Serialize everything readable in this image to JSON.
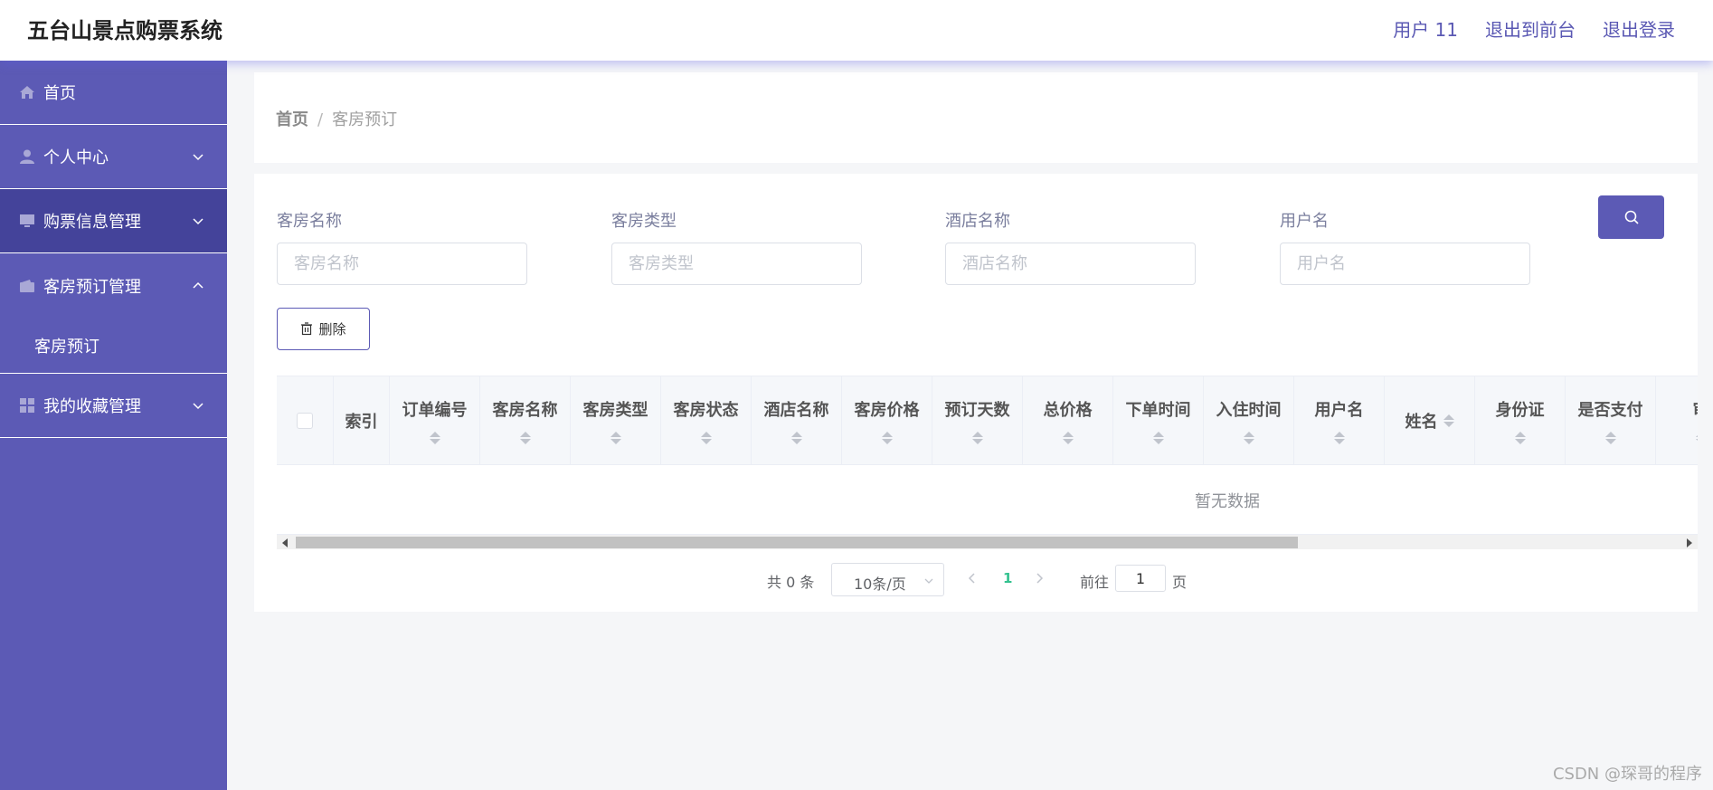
{
  "app": {
    "title": "五台山景点购票系统"
  },
  "header": {
    "links": [
      "用户 11",
      "退出到前台",
      "退出登录"
    ]
  },
  "sidebar": {
    "items": [
      {
        "label": "首页",
        "icon": "home-icon",
        "expanded": null
      },
      {
        "label": "个人中心",
        "icon": "user-icon",
        "expanded": false
      },
      {
        "label": "购票信息管理",
        "icon": "monitor-icon",
        "expanded": false,
        "active": true
      },
      {
        "label": "客房预订管理",
        "icon": "wallet-icon",
        "expanded": true
      },
      {
        "label": "客房预订",
        "icon": "",
        "sub": true
      },
      {
        "label": "我的收藏管理",
        "icon": "grid-icon",
        "expanded": false
      }
    ]
  },
  "breadcrumb": {
    "home": "首页",
    "separator": "/",
    "current": "客房预订"
  },
  "search": {
    "fields": [
      {
        "label": "客房名称",
        "placeholder": "客房名称"
      },
      {
        "label": "客房类型",
        "placeholder": "客房类型"
      },
      {
        "label": "酒店名称",
        "placeholder": "酒店名称"
      },
      {
        "label": "用户名",
        "placeholder": "用户名"
      }
    ],
    "button_icon": "search-icon"
  },
  "actions": {
    "delete_label": "删除"
  },
  "table": {
    "index_label": "索引",
    "columns": [
      "订单编号",
      "客房名称",
      "客房类型",
      "客房状态",
      "酒店名称",
      "客房价格",
      "预订天数",
      "总价格",
      "下单时间",
      "入住时间",
      "用户名",
      "姓名",
      "身份证",
      "是否支付",
      "审"
    ],
    "empty_text": "暂无数据"
  },
  "pagination": {
    "total": "共 0 条",
    "page_size": "10条/页",
    "current_page": "1",
    "goto_label": "前往",
    "goto_value": "1",
    "page_suffix": "页"
  },
  "watermark": "CSDN @琛哥的程序",
  "colors": {
    "sidebar": "#5c5ab5",
    "sidebar_active": "#44439a",
    "accent": "#5c5ab5",
    "page_number": "#34c28f"
  }
}
